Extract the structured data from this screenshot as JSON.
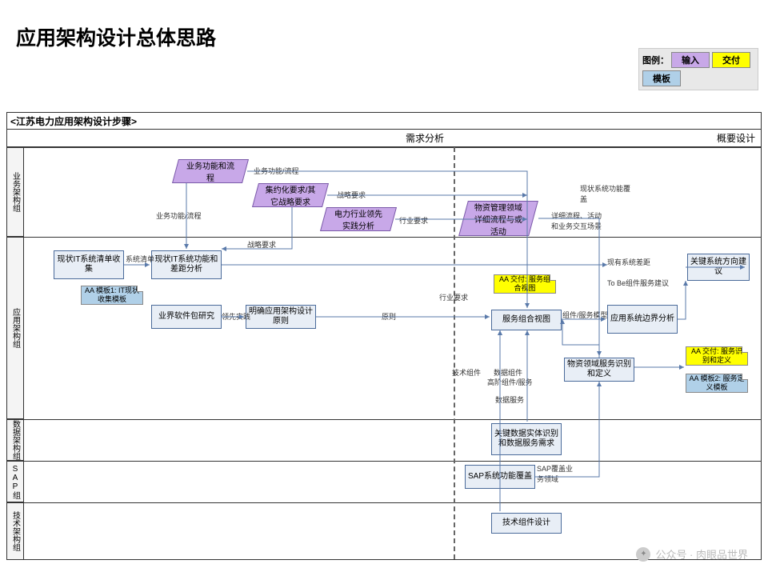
{
  "title": "应用架构设计总体思路",
  "legend": {
    "label": "图例：",
    "input": "输入",
    "deliver": "交付",
    "template": "模板"
  },
  "frame_header": "<江苏电力应用架构设计步骤>",
  "phases": {
    "p1": "需求分析",
    "p2": "概要设计"
  },
  "lanes": {
    "biz": "业务架构组",
    "app": "应用架构组",
    "data": "数据架构组",
    "sap": "SAP组",
    "tech": "技术架构组"
  },
  "inputs": {
    "i1": "业务功能和流程",
    "i2": "集约化要求/其它战略要求",
    "i3": "电力行业领先实践分析",
    "i4": "物资管理领域详细流程与或活动"
  },
  "boxes": {
    "b1": "现状IT系统清单收集",
    "b2": "现状IT系统功能和差距分析",
    "b3": "业界软件包研究",
    "b4": "明确应用架构设计原则",
    "b5": "服务组合视图",
    "b6": "应用系统边界分析",
    "b7": "物资领域服务识别和定义",
    "b8": "关键数据实体识别和数据服务需求",
    "b9": "SAP系统功能覆盖",
    "b10": "技术组件设计",
    "b11": "关键系统方向建议"
  },
  "notes": {
    "n1": "AA 模板1: IT现状收集模板",
    "n2": "AA 交付: 服务组合视图",
    "n3": "AA 交付: 服务识别和定义",
    "n4": "AA 模板2: 服务定义模板"
  },
  "labels": {
    "l1": "系统清单",
    "l2": "业务功能/流程",
    "l3": "业务功能/流程",
    "l4": "战略要求",
    "l5": "战略要求",
    "l6": "行业要求",
    "l7": "领先实践",
    "l8": "原则",
    "l9": "行业要求",
    "l10": "技术组件",
    "l11": "数据组件",
    "l12": "组件/服务模型",
    "l13": "高阶组件/服务",
    "l14": "数据服务",
    "l15": "SAP覆盖业务领域",
    "l16": "详细流程、活动和业务交互场景",
    "l17": "现状系统功能覆盖",
    "l18": "现有系统差距",
    "l19": "To Be组件服务建议"
  },
  "watermark": "公众号 · 肉眼品世界"
}
